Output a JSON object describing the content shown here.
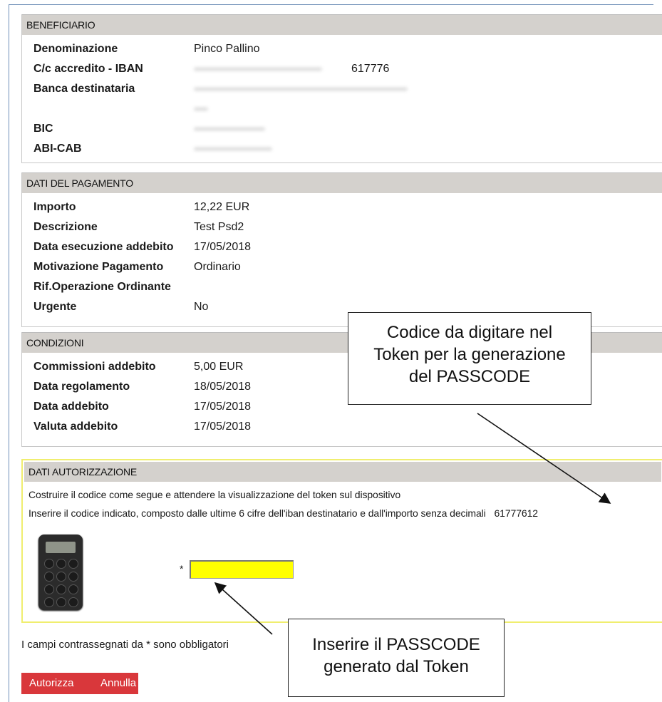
{
  "beneficiario": {
    "header": "BENEFICIARIO",
    "rows": [
      {
        "label": "Denominazione",
        "value": "Pinco Pallino"
      },
      {
        "label": "C/c accredito - IBAN",
        "value": "617776"
      },
      {
        "label": "Banca destinataria",
        "value": ""
      },
      {
        "label": "BIC",
        "value": ""
      },
      {
        "label": "ABI-CAB",
        "value": ""
      }
    ]
  },
  "pagamento": {
    "header": "DATI DEL PAGAMENTO",
    "rows": [
      {
        "label": "Importo",
        "value": "12,22 EUR"
      },
      {
        "label": "Descrizione",
        "value": "Test Psd2"
      },
      {
        "label": "Data esecuzione addebito",
        "value": "17/05/2018"
      },
      {
        "label": "Motivazione Pagamento",
        "value": "Ordinario"
      },
      {
        "label": "Rif.Operazione Ordinante",
        "value": ""
      },
      {
        "label": "Urgente",
        "value": "No"
      }
    ]
  },
  "condizioni": {
    "header": "CONDIZIONI",
    "rows": [
      {
        "label": "Commissioni addebito",
        "value": "5,00 EUR"
      },
      {
        "label": "Data regolamento",
        "value": "18/05/2018"
      },
      {
        "label": "Data addebito",
        "value": "17/05/2018"
      },
      {
        "label": "Valuta addebito",
        "value": "17/05/2018"
      }
    ]
  },
  "autorizzazione": {
    "header": "DATI AUTORIZZAZIONE",
    "line1": "Costruire il codice come segue e attendere la visualizzazione del token sul dispositivo",
    "line2": "Inserire il codice indicato, composto dalle ultime 6 cifre dell'iban destinatario e dall'importo senza decimali",
    "code": "61777612",
    "asterisk": "*",
    "passcode_value": ""
  },
  "footer": {
    "required_note": "I campi contrassegnati da * sono obbligatori",
    "authorize_label": "Autorizza",
    "cancel_label": "Annulla"
  },
  "callouts": {
    "token_code": [
      "Codice da digitare nel",
      "Token per la generazione",
      "del PASSCODE"
    ],
    "passcode": [
      "Inserire il PASSCODE",
      "generato dal Token"
    ]
  },
  "colors": {
    "header_bg": "#d4d1cd",
    "auth_border": "#f0ee6f",
    "input_bg": "#ffff00",
    "button_bg": "#d9373b"
  }
}
